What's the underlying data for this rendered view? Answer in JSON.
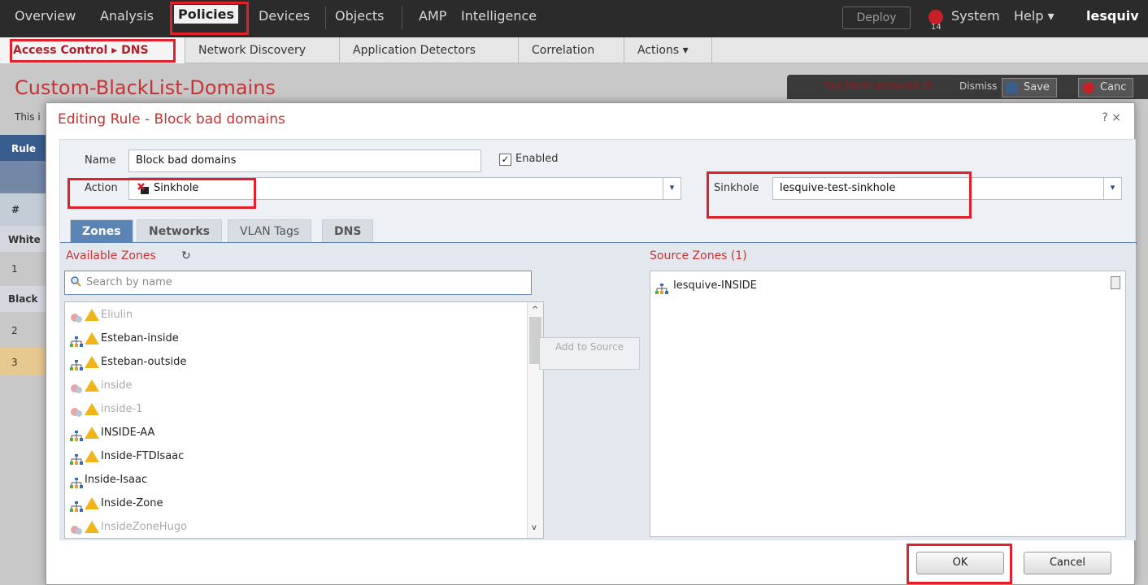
{
  "topnav": {
    "items": [
      "Overview",
      "Analysis",
      "Policies",
      "Devices",
      "Objects",
      "AMP",
      "Intelligence"
    ],
    "deploy": "Deploy",
    "alert_count": "14",
    "system": "System",
    "help": "Help ▾",
    "user": "lesquiv"
  },
  "subnav": {
    "items": [
      "Access Control ▸ DNS",
      "Network Discovery",
      "Application Detectors",
      "Correlation",
      "Actions ▾"
    ]
  },
  "page": {
    "title": "Custom-BlackList-Domains",
    "desc_fragment": "This i",
    "unsaved": "You have unsaved ch",
    "dismiss": "Dismiss",
    "save": "Save",
    "cancel": "Canc",
    "left_labels": [
      "Rule",
      "#",
      "White",
      "1",
      "Black",
      "2",
      "3"
    ]
  },
  "modal": {
    "title": "Editing Rule - Block bad domains",
    "controls": "? ×",
    "name_label": "Name",
    "name_value": "Block bad domains",
    "enabled_label": "Enabled",
    "action_label": "Action",
    "action_value": "Sinkhole",
    "sinkhole_label": "Sinkhole",
    "sinkhole_value": "lesquive-test-sinkhole",
    "tabs": [
      "Zones",
      "Networks",
      "VLAN Tags",
      "DNS"
    ],
    "available_title": "Available Zones",
    "search_placeholder": "Search by name",
    "zones": [
      {
        "name": "Eliulin",
        "disabled": true,
        "warn": true
      },
      {
        "name": "Esteban-inside",
        "disabled": false,
        "warn": true
      },
      {
        "name": "Esteban-outside",
        "disabled": false,
        "warn": true
      },
      {
        "name": "inside",
        "disabled": true,
        "warn": true
      },
      {
        "name": "inside-1",
        "disabled": true,
        "warn": true
      },
      {
        "name": "INSIDE-AA",
        "disabled": false,
        "warn": true
      },
      {
        "name": "Inside-FTDIsaac",
        "disabled": false,
        "warn": true
      },
      {
        "name": "Inside-Isaac",
        "disabled": false,
        "warn": false
      },
      {
        "name": "Inside-Zone",
        "disabled": false,
        "warn": true
      },
      {
        "name": "InsideZoneHugo",
        "disabled": true,
        "warn": true
      }
    ],
    "add_to_source": "Add to Source",
    "source_title": "Source Zones (1)",
    "source_zones": [
      "lesquive-INSIDE"
    ],
    "ok": "OK",
    "cancel": "Cancel"
  },
  "colors": {
    "accent_red": "#c83232",
    "tab_blue": "#5a84b4",
    "highlight": "#e0202a"
  }
}
